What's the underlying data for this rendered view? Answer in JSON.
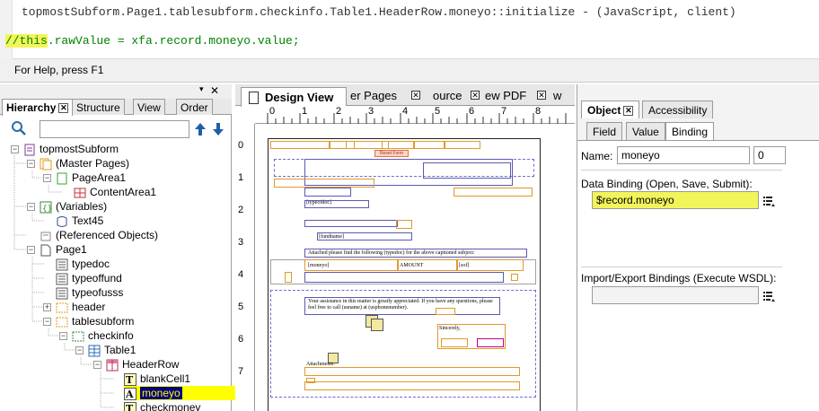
{
  "script_editor": {
    "title": "topmostSubform.Page1.tablesubform.checkinfo.Table1.HeaderRow.moneyo::initialize - (JavaScript, client)",
    "code_prefix": "//this",
    "code_rest": ".rawValue = xfa.record.moneyo.value;",
    "highlight_color": "#f2f55a"
  },
  "status_bar": {
    "text": "For Help, press F1"
  },
  "hierarchy": {
    "tabs": [
      {
        "label": "Hierarchy",
        "active": true
      },
      {
        "label": "Structure"
      },
      {
        "label": "View"
      },
      {
        "label": "Order"
      }
    ],
    "search_placeholder": "",
    "tree": [
      {
        "label": "topmostSubform",
        "icon": "form-icon"
      },
      {
        "label": "(Master Pages)",
        "icon": "master-pages-icon"
      },
      {
        "label": "PageArea1",
        "icon": "page-area-icon"
      },
      {
        "label": "ContentArea1",
        "icon": "content-area-icon"
      },
      {
        "label": "(Variables)",
        "icon": "variables-icon"
      },
      {
        "label": "Text45",
        "icon": "script-object-icon"
      },
      {
        "label": "(Referenced Objects)",
        "icon": "referenced-objects-icon"
      },
      {
        "label": "Page1",
        "icon": "page-icon"
      },
      {
        "label": "typedoc",
        "icon": "field-list-icon"
      },
      {
        "label": "typeoffund",
        "icon": "field-list-icon"
      },
      {
        "label": "typeofusss",
        "icon": "field-list-icon"
      },
      {
        "label": "header",
        "icon": "subform-icon"
      },
      {
        "label": "tablesubform",
        "icon": "subform-icon"
      },
      {
        "label": "checkinfo",
        "icon": "subform-icon"
      },
      {
        "label": "Table1",
        "icon": "table-icon"
      },
      {
        "label": "HeaderRow",
        "icon": "header-row-icon"
      },
      {
        "label": "blankCell1",
        "icon": "text-icon"
      },
      {
        "label": "moneyo",
        "icon": "text-field-icon",
        "selected": true
      },
      {
        "label": "checkmoney",
        "icon": "text-icon"
      }
    ]
  },
  "design_view": {
    "tabs": [
      {
        "label": "Design View",
        "active": true
      },
      {
        "label": "er Pages"
      },
      {
        "label": "ource"
      },
      {
        "label": "ew PDF"
      },
      {
        "label": "w"
      }
    ],
    "ruler_h": [
      "0",
      "1",
      "2",
      "3",
      "4",
      "5",
      "6",
      "7",
      "8"
    ],
    "ruler_v": [
      "0",
      "1",
      "2",
      "3",
      "4",
      "5",
      "6",
      "7"
    ],
    "page": {
      "reset_button": "Reset Form",
      "typeofdoc": "[typeofdoc]",
      "fundname": "[fundname]",
      "attached_line": "Attached please find the following (typedoc) for the above captioned subject:",
      "col_moneyo": "[moneyo]",
      "col_amount": "AMOUNT",
      "col_sof": "[sof]",
      "assist_text": "Your assistance in this matter is greatly appreciated.  If you have any questions, please feel free to call  (usname) at  (usphonenumber).",
      "sincerely": "Sincerely,",
      "attachments": "Attachments:"
    }
  },
  "object_panel": {
    "tabs": [
      {
        "label": "Object",
        "active": true
      },
      {
        "label": "Accessibility"
      }
    ],
    "subtabs": [
      {
        "label": "Field"
      },
      {
        "label": "Value"
      },
      {
        "label": "Binding",
        "active": true
      }
    ],
    "name_label": "Name:",
    "name_value": "moneyo",
    "name_count": "0",
    "data_binding_label": "Data Binding (Open, Save, Submit):",
    "data_binding_value": "$record.moneyo",
    "import_export_label": "Import/Export Bindings (Execute WSDL):",
    "import_export_value": ""
  }
}
